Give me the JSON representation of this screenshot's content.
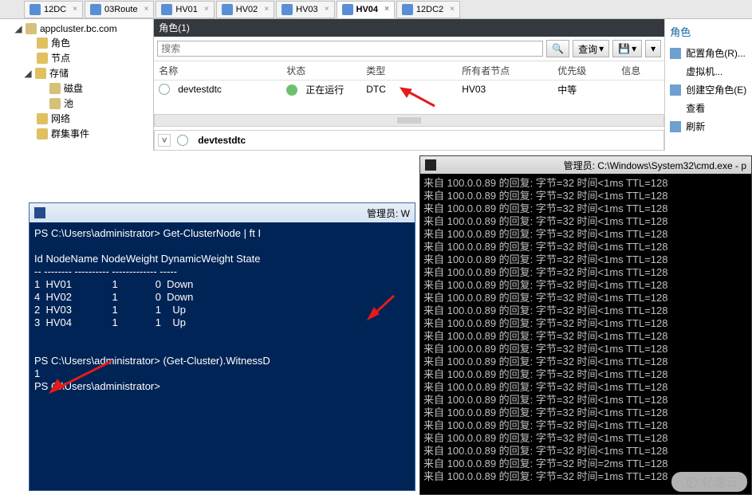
{
  "tabs": [
    {
      "label": "12DC"
    },
    {
      "label": "03Route"
    },
    {
      "label": "HV01"
    },
    {
      "label": "HV02"
    },
    {
      "label": "HV03"
    },
    {
      "label": "HV04",
      "active": true
    },
    {
      "label": "12DC2"
    }
  ],
  "tree": {
    "root": "appcluster.bc.com",
    "items": [
      "角色",
      "节点"
    ],
    "storage": {
      "label": "存储",
      "children": [
        "磁盘",
        "池"
      ]
    },
    "extra": [
      "网络",
      "群集事件"
    ]
  },
  "roles_panel": {
    "heading": "角色(1)",
    "search_placeholder": "搜索",
    "query_btn": "查询",
    "columns": {
      "name": "名称",
      "state": "状态",
      "type": "类型",
      "owner": "所有者节点",
      "priority": "优先级",
      "info": "信息"
    },
    "row": {
      "name": "devtestdtc",
      "state": "正在运行",
      "type": "DTC",
      "owner": "HV03",
      "priority": "中等",
      "info": ""
    },
    "subpanel_name": "devtestdtc"
  },
  "actions": {
    "title": "角色",
    "items": [
      "配置角色(R)...",
      "虚拟机...",
      "创建空角色(E)",
      "查看",
      "刷新"
    ]
  },
  "ps": {
    "title": "管理员: W",
    "body": "PS C:\\Users\\administrator> Get-ClusterNode | ft I\n\nId NodeName NodeWeight DynamicWeight State\n-- -------- ---------- ------------- -----\n1  HV01              1             0  Down\n4  HV02              1             0  Down\n2  HV03              1             1    Up\n3  HV04              1             1    Up\n\n\nPS C:\\Users\\administrator> (Get-Cluster).WitnessD\n1\nPS C:\\Users\\administrator>\n"
  },
  "cmd": {
    "title": "管理员: C:\\Windows\\System32\\cmd.exe - p",
    "ip": "100.0.0.89",
    "prefix": "来自 ",
    "mid": " 的回复: 字节=32 时间",
    "t1": "<1ms",
    "t2": "=1ms",
    "t3": "=2ms",
    "ttl": " TTL=128",
    "lines": 24
  },
  "watermark": "亿速云"
}
